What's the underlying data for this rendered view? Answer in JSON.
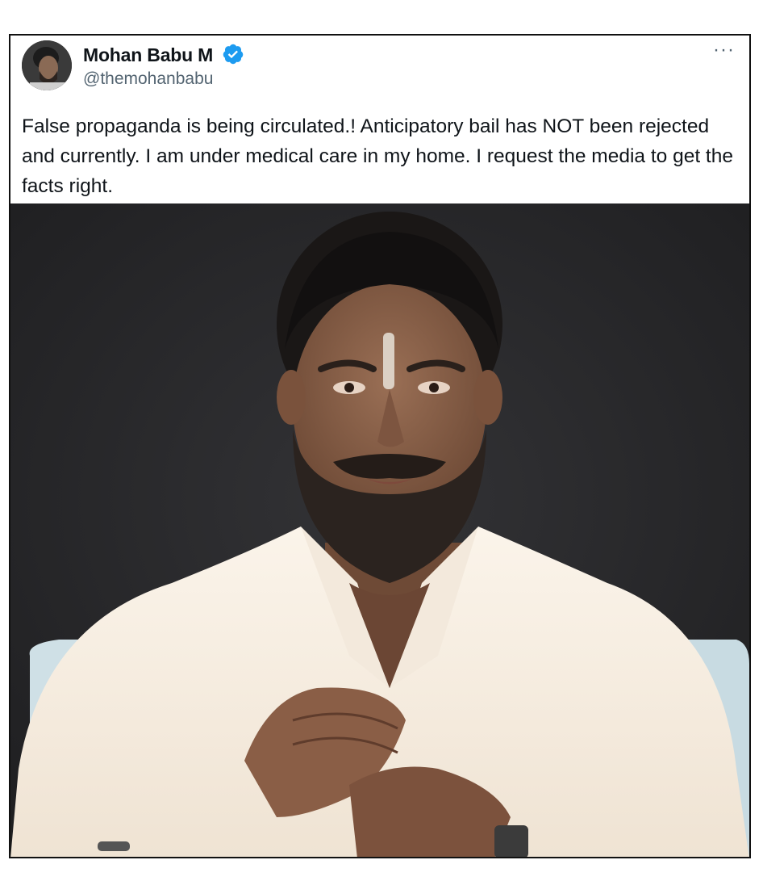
{
  "tweet": {
    "author_name": "Mohan Babu M",
    "handle": "@themohanbabu",
    "verified_icon": "verified-badge-icon",
    "more_icon": "more-options-icon",
    "more_label": "···",
    "text": "False propaganda  is being circulated.! Anticipatory bail has NOT been rejected and currently. I am under medical care in my home. I request the media to get the facts right."
  },
  "colors": {
    "verified": "#1d9bf0",
    "handle": "#536471",
    "text": "#0f1419",
    "photo_background": "#2a2a2c",
    "shirt": "#f7efe4"
  }
}
